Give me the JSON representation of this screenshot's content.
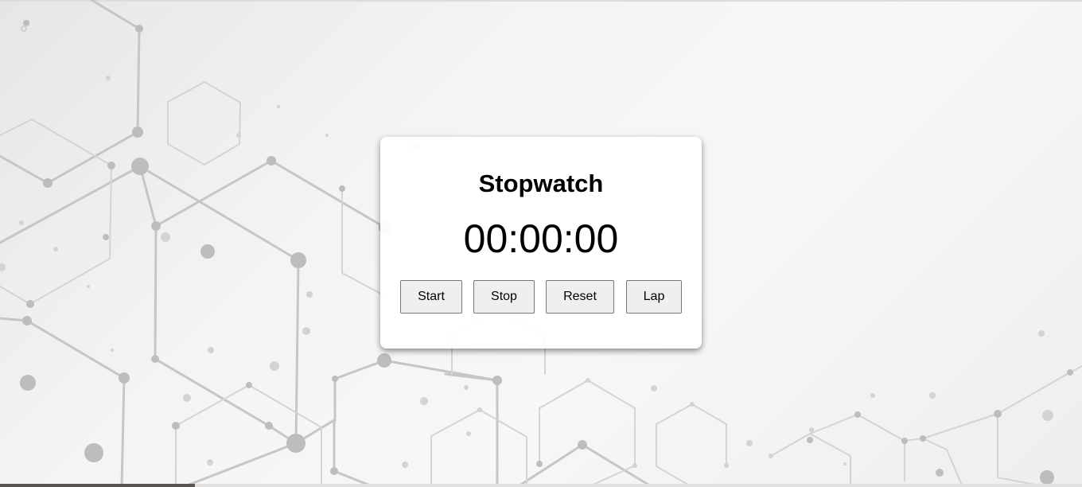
{
  "stopwatch": {
    "title": "Stopwatch",
    "time": "00:00:00",
    "buttons": {
      "start": "Start",
      "stop": "Stop",
      "reset": "Reset",
      "lap": "Lap"
    }
  },
  "colors": {
    "background": "#f4f4f4",
    "hex_pattern": "#c4c4c4",
    "card": "#ffffff",
    "button": "#efefef"
  }
}
